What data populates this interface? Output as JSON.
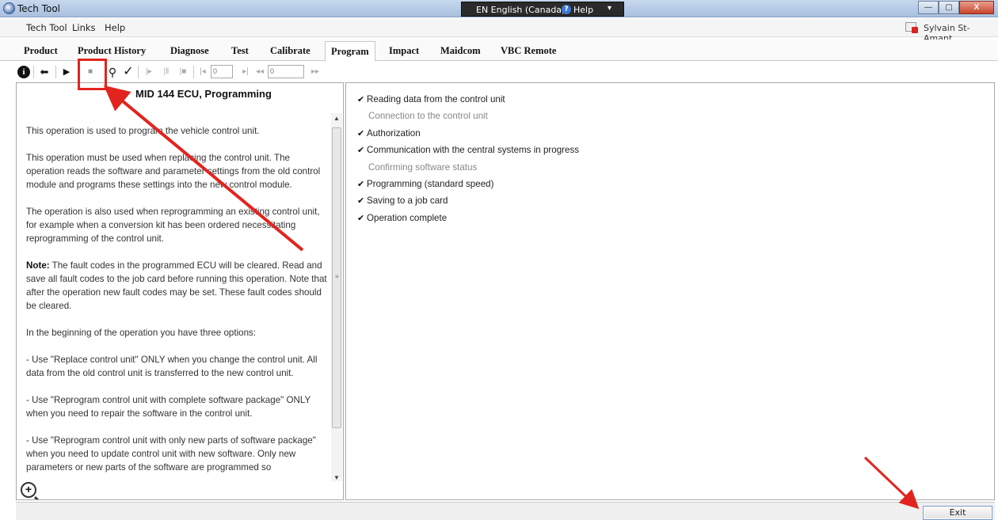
{
  "window": {
    "title": "Tech Tool",
    "language": "EN English (Canada)",
    "help_label": "Help",
    "pin_glyph": "▾",
    "buttons": {
      "minimize": "—",
      "maximize": "▢",
      "close": "X"
    }
  },
  "menu": {
    "items": [
      "Tech Tool",
      "Links",
      "Help"
    ],
    "user_name": "Sylvain St-Amant"
  },
  "tabs": [
    "Product",
    "Product History",
    "Diagnose",
    "Test",
    "Calibrate",
    "Program",
    "Impact",
    "Maidcom",
    "VBC Remote"
  ],
  "active_tab": "Program",
  "toolbar": {
    "info": "i",
    "back": "⬅",
    "play": "▶",
    "stop": "■",
    "search": "⚲",
    "check": "✓",
    "step1": "|▸",
    "step2": "|‖",
    "step3": "|■",
    "prev": "|◂",
    "input1": "0",
    "next": "▸|",
    "rewind": "◂◂",
    "input2": "0",
    "forward": "▸▸"
  },
  "description": {
    "title": "MID 144 ECU, Programming",
    "paragraphs": [
      "This operation is used to program the vehicle control unit.",
      "This operation must be used when replacing the control unit. The operation reads the software and parameter settings from the old control module and programs these settings into the new control module.",
      "The operation is also used when reprogramming an existing control unit, for example when a conversion kit has been ordered necessitating reprogramming of the control unit."
    ],
    "note_label": "Note:",
    "note_text": " The fault codes in the programmed ECU will be cleared. Read and save all fault codes to the job card before running this operation. Note that after the operation new fault codes may be set. These fault codes should be cleared.",
    "paragraphs_after": [
      "In the beginning of the operation you have three options:",
      "- Use \"Replace control unit\" ONLY when you change the control unit. All data from the old control unit is transferred to the new control unit.",
      "- Use \"Reprogram control unit with complete software package\" ONLY when you need to repair the software in the control unit.",
      "- Use \"Reprogram control unit with only new parts of software package\" when you need to update control unit with new software. Only new parameters or new parts of the software are programmed so"
    ]
  },
  "steps": [
    {
      "label": "Reading data from the control unit",
      "done": true
    },
    {
      "label": "Connection to the control unit",
      "done": false
    },
    {
      "label": "Authorization",
      "done": true
    },
    {
      "label": "Communication with the central systems in progress",
      "done": true
    },
    {
      "label": "Confirming software status",
      "done": false
    },
    {
      "label": "Programming  (standard speed)",
      "done": true
    },
    {
      "label": "Saving to a job card",
      "done": true
    },
    {
      "label": "Operation complete",
      "done": true
    }
  ],
  "check_glyph": "✔",
  "exit_label": "Exit",
  "zoom_glyph": "+",
  "colors": {
    "annotation": "#e2241f"
  }
}
